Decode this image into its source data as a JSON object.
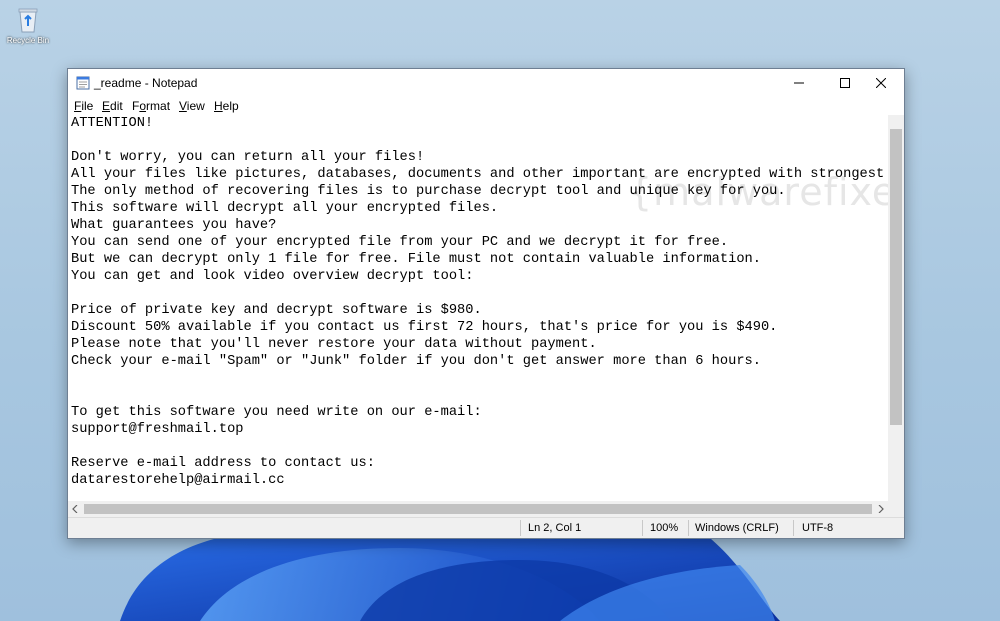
{
  "desktop": {
    "recycle_bin_label": "Recycle Bin"
  },
  "window": {
    "title": "_readme - Notepad",
    "menu": [
      {
        "label": "File",
        "accel": "F",
        "rest": "ile"
      },
      {
        "label": "Edit",
        "accel": "E",
        "rest": "dit"
      },
      {
        "label": "Format",
        "accel": "o",
        "pre": "F",
        "rest": "rmat"
      },
      {
        "label": "View",
        "accel": "V",
        "rest": "iew"
      },
      {
        "label": "Help",
        "accel": "H",
        "rest": "elp"
      }
    ]
  },
  "document": {
    "lines": [
      "ATTENTION!",
      "",
      "Don't worry, you can return all your files!",
      "All your files like pictures, databases, documents and other important are encrypted with strongest en",
      "The only method of recovering files is to purchase decrypt tool and unique key for you.",
      "This software will decrypt all your encrypted files.",
      "What guarantees you have?",
      "You can send one of your encrypted file from your PC and we decrypt it for free.",
      "But we can decrypt only 1 file for free. File must not contain valuable information.",
      "You can get and look video overview decrypt tool:",
      "",
      "Price of private key and decrypt software is $980.",
      "Discount 50% available if you contact us first 72 hours, that's price for you is $490.",
      "Please note that you'll never restore your data without payment.",
      "Check your e-mail \"Spam\" or \"Junk\" folder if you don't get answer more than 6 hours.",
      "",
      "",
      "To get this software you need write on our e-mail:",
      "support@freshmail.top",
      "",
      "Reserve e-mail address to contact us:",
      "datarestorehelp@airmail.cc"
    ]
  },
  "watermark": "{malwarefixes}",
  "status": {
    "position": "Ln 2, Col 1",
    "zoom": "100%",
    "line_endings": "Windows (CRLF)",
    "encoding": "UTF-8"
  },
  "colors": {
    "desktop_bg": "#a8c7e0",
    "bloom": "#1448c8"
  }
}
